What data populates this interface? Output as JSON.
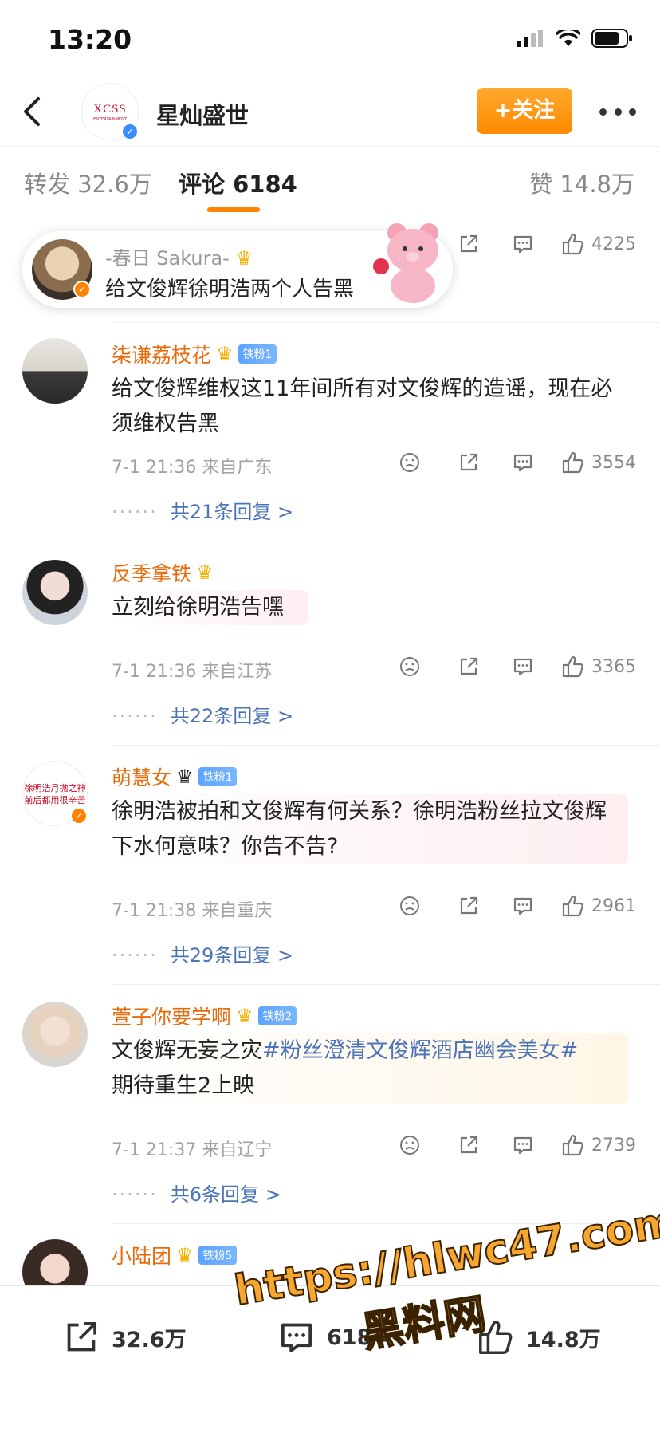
{
  "status_bar": {
    "time": "13:20"
  },
  "header": {
    "account_name": "星灿盛世",
    "avatar_logo": "XCSS",
    "avatar_logo_sub": "ENTERTAINMENT",
    "follow_label": "+关注"
  },
  "tabs": [
    {
      "label": "转发 32.6万"
    },
    {
      "label": "评论 6184"
    },
    {
      "label": "赞 14.8万"
    }
  ],
  "floating_comment": {
    "name": "-春日 Sakura-",
    "text": "给文俊辉徐明浩两个人告黑",
    "likes": "4225"
  },
  "comments": [
    {
      "name": "柒谦荔枝花",
      "badge": "铁粉1",
      "text": "给文俊辉维权这11年间所有对文俊辉的造谣，现在必须维权告黑",
      "meta": "7-1 21:36  来自广东",
      "likes": "3554",
      "replies": "共21条回复 >"
    },
    {
      "name": "反季拿铁",
      "badge": "",
      "text": "立刻给徐明浩告嘿",
      "meta": "7-1 21:36  来自江苏",
      "likes": "3365",
      "replies": "共22条回复 >"
    },
    {
      "name": "萌慧女",
      "badge": "铁粉1",
      "avatar_text": "徐明浩月抛之神 前后都用很辛苦",
      "text": "徐明浩被拍和文俊辉有何关系？徐明浩粉丝拉文俊辉下水何意味？你告不告?",
      "meta": "7-1 21:38  来自重庆",
      "likes": "2961",
      "replies": "共29条回复 >"
    },
    {
      "name": "萱子你要学啊",
      "badge": "铁粉2",
      "text_plain": "文俊辉无妄之灾",
      "text_hashtag": "#粉丝澄清文俊辉酒店幽会美女#",
      "text_after": "期待重生2上映",
      "meta": "7-1 21:37  来自辽宁",
      "likes": "2739",
      "replies": "共6条回复 >"
    },
    {
      "name": "小陆团",
      "badge": "铁粉5"
    }
  ],
  "bottom_bar": {
    "repost_count": "32.6万",
    "comment_count": "6184",
    "like_count": "14.8万"
  },
  "watermark": {
    "url": "https://hlwc47.com",
    "title": "黑料网"
  },
  "colors": {
    "accent": "#ff8200",
    "name": "#e86b0a",
    "link": "#4a73b8",
    "fan_badge": "#5ca4ff"
  }
}
